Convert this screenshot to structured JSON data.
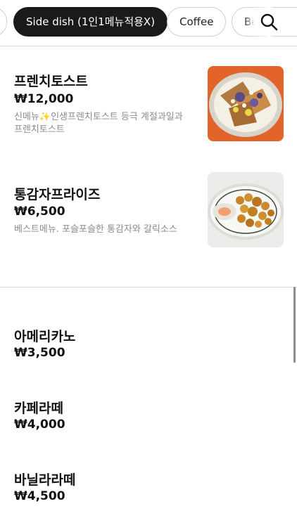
{
  "categories": {
    "items": [
      {
        "label": ""
      },
      {
        "label": "Side dish (1인1메뉴적용X)"
      },
      {
        "label": "Coffee"
      },
      {
        "label": "Be"
      }
    ],
    "active_index": 1
  },
  "search": {
    "icon": "search-icon"
  },
  "side_dish_items": [
    {
      "name": "프렌치토스트",
      "price": "₩12,000",
      "desc": "신메뉴✨인생프렌치토스트 등극 계절과일과 프렌치토스트",
      "image": "french-toast-photo"
    },
    {
      "name": "통감자프라이즈",
      "price": "₩6,500",
      "desc": "베스트메뉴. 포슬포슬한 통감자와 갈릭소스",
      "image": "potato-fries-photo"
    }
  ],
  "coffee_items": [
    {
      "name": "아메리카노",
      "price": "₩3,500"
    },
    {
      "name": "카페라떼",
      "price": "₩4,000"
    },
    {
      "name": "바닐라라떼",
      "price": "₩4,500"
    }
  ],
  "colors": {
    "chip_active": "#1a1a1a",
    "price": "#111111",
    "desc": "#8a8a8a",
    "divider": "#d6d6d6"
  }
}
